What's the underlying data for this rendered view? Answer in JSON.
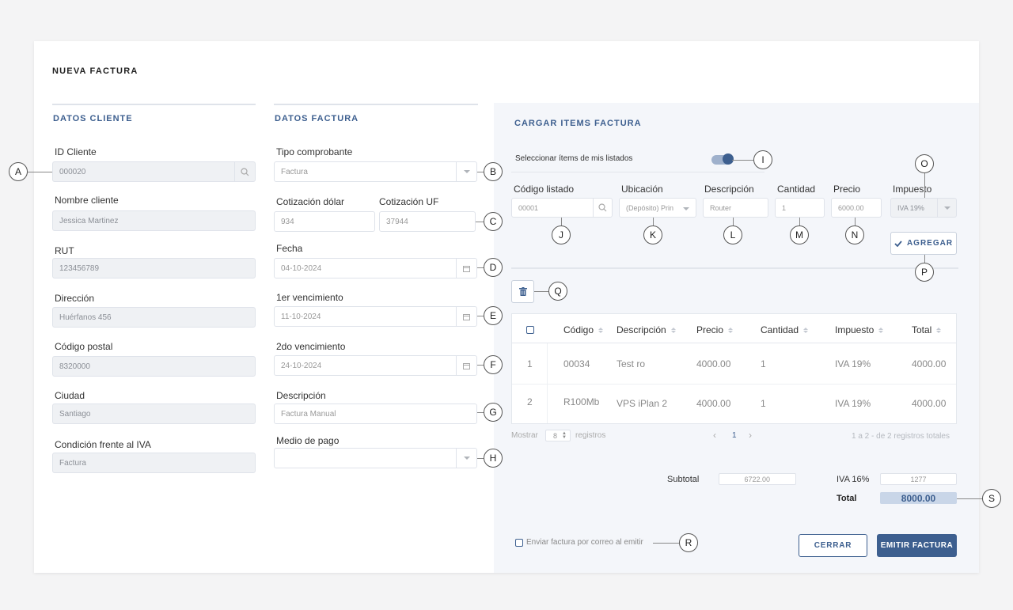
{
  "page_title": "NUEVA FACTURA",
  "cliente": {
    "title": "DATOS CLIENTE",
    "id_label": "ID Cliente",
    "id_value": "000020",
    "nombre_label": "Nombre cliente",
    "nombre_value": "Jessica Martinez",
    "rut_label": "RUT",
    "rut_value": "123456789",
    "direccion_label": "Dirección",
    "direccion_value": "Huérfanos 456",
    "postal_label": "Código postal",
    "postal_value": "8320000",
    "ciudad_label": "Ciudad",
    "ciudad_value": "Santiago",
    "iva_label": "Condición frente al IVA",
    "iva_value": "Factura"
  },
  "factura": {
    "title": "DATOS FACTURA",
    "tipo_label": "Tipo comprobante",
    "tipo_value": "Factura",
    "dolar_label": "Cotización dólar",
    "dolar_value": "934",
    "uf_label": "Cotización UF",
    "uf_value": "37944",
    "fecha_label": "Fecha",
    "fecha_value": "04-10-2024",
    "venc1_label": "1er vencimiento",
    "venc1_value": "11-10-2024",
    "venc2_label": "2do vencimiento",
    "venc2_value": "24-10-2024",
    "desc_label": "Descripción",
    "desc_value": "Factura Manual",
    "pago_label": "Medio de pago",
    "pago_value": ""
  },
  "items": {
    "title": "CARGAR ITEMS FACTURA",
    "toggle_label": "Seleccionar ítems de mis listados",
    "codigo_label": "Código listado",
    "codigo_value": "00001",
    "ubicacion_label": "Ubicación",
    "ubicacion_value": "(Depósito) Prin",
    "descripcion_label": "Descripción",
    "descripcion_value": "Router",
    "cantidad_label": "Cantidad",
    "cantidad_value": "1",
    "precio_label": "Precio",
    "precio_value": "6000.00",
    "impuesto_label": "Impuesto",
    "impuesto_value": "IVA 19%",
    "add_button": "AGREGAR"
  },
  "table": {
    "headers": [
      "Código",
      "Descripción",
      "Precio",
      "Cantidad",
      "Impuesto",
      "Total"
    ],
    "rows": [
      {
        "num": "1",
        "codigo": "00034",
        "descripcion": "Test ro",
        "precio": "4000.00",
        "cantidad": "1",
        "impuesto": "IVA 19%",
        "total": "4000.00"
      },
      {
        "num": "2",
        "codigo": "R100Mb",
        "descripcion": "VPS iPlan 2",
        "precio": "4000.00",
        "cantidad": "1",
        "impuesto": "IVA 19%",
        "total": "4000.00"
      }
    ]
  },
  "pagination": {
    "show_label": "Mostrar",
    "per_page": "8",
    "records_label": "registros",
    "page": "1",
    "summary": "1 a 2 - de 2 registros totales"
  },
  "totals": {
    "subtotal_label": "Subtotal",
    "subtotal_value": "6722.00",
    "iva_label": "IVA 16%",
    "iva_value": "1277",
    "total_label": "Total",
    "total_value": "8000.00"
  },
  "footer": {
    "email_label": "Enviar factura por correo al emitir",
    "close_button": "CERRAR",
    "emit_button": "EMITIR FACTURA"
  },
  "callouts": {
    "a": "A",
    "b": "B",
    "c": "C",
    "d": "D",
    "e": "E",
    "f": "F",
    "g": "G",
    "h": "H",
    "i": "I",
    "j": "J",
    "k": "K",
    "l": "L",
    "m": "M",
    "n": "N",
    "o": "O",
    "p": "P",
    "q": "Q",
    "r": "R",
    "s": "S"
  },
  "colors": {
    "accent": "#3d5f8f",
    "panel": "#f4f6fa",
    "total_highlight": "#c9d6e8"
  }
}
